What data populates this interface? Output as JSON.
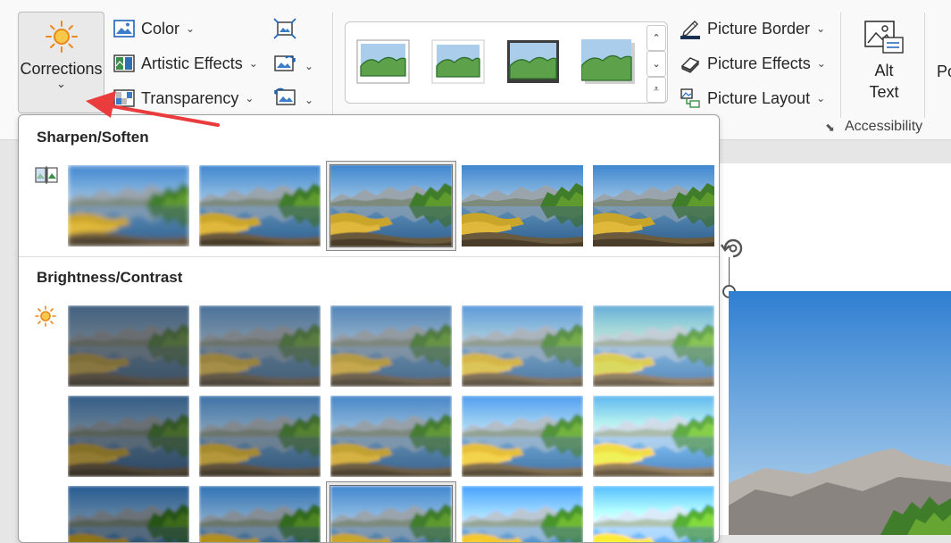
{
  "ribbon": {
    "corrections": {
      "label": "Corrections",
      "chevron": "⌄",
      "icon": "sun-icon"
    },
    "color": {
      "label": "Color",
      "icon": "color-picture-icon"
    },
    "artistic_effects": {
      "label": "Artistic Effects",
      "icon": "artistic-effects-icon"
    },
    "transparency": {
      "label": "Transparency",
      "icon": "transparency-icon"
    },
    "compress": {
      "icon": "compress-pictures-icon"
    },
    "change_picture": {
      "icon": "change-picture-icon"
    },
    "reset_picture": {
      "icon": "reset-picture-icon"
    },
    "picture_border": {
      "label": "Picture Border",
      "icon": "pen-border-icon"
    },
    "picture_effects": {
      "label": "Picture Effects",
      "icon": "eraser-effects-icon"
    },
    "picture_layout": {
      "label": "Picture Layout",
      "icon": "layout-icon"
    },
    "alt_text": {
      "line1": "Alt",
      "line2": "Text",
      "icon": "alt-text-icon"
    },
    "accessibility_label": "Accessibility",
    "cut_label": "Po",
    "dropdown_glyph": "⌄"
  },
  "panel": {
    "sharpen": {
      "title": "Sharpen/Soften",
      "blur": [
        3,
        1.7,
        0.6,
        0.25,
        0
      ],
      "selected_index": 2
    },
    "brightness": {
      "title": "Brightness/Contrast",
      "rows": [
        [
          {
            "b": 0.62,
            "c": 0.7
          },
          {
            "b": 0.8,
            "c": 0.7
          },
          {
            "b": 1.0,
            "c": 0.72
          },
          {
            "b": 1.22,
            "c": 0.72
          },
          {
            "b": 1.45,
            "c": 0.7
          }
        ],
        [
          {
            "b": 0.66,
            "c": 0.88
          },
          {
            "b": 0.84,
            "c": 0.88
          },
          {
            "b": 1.0,
            "c": 0.9
          },
          {
            "b": 1.2,
            "c": 0.9
          },
          {
            "b": 1.42,
            "c": 0.88
          }
        ],
        [
          {
            "b": 0.7,
            "c": 1.08
          },
          {
            "b": 0.86,
            "c": 1.08
          },
          {
            "b": 1.0,
            "c": 1.0
          },
          {
            "b": 1.18,
            "c": 1.08
          },
          {
            "b": 1.38,
            "c": 1.08
          }
        ]
      ],
      "selected": [
        2,
        2
      ]
    }
  },
  "colors": {
    "accent_arrow": "#ea3c3c",
    "sun": "#e8891c"
  }
}
